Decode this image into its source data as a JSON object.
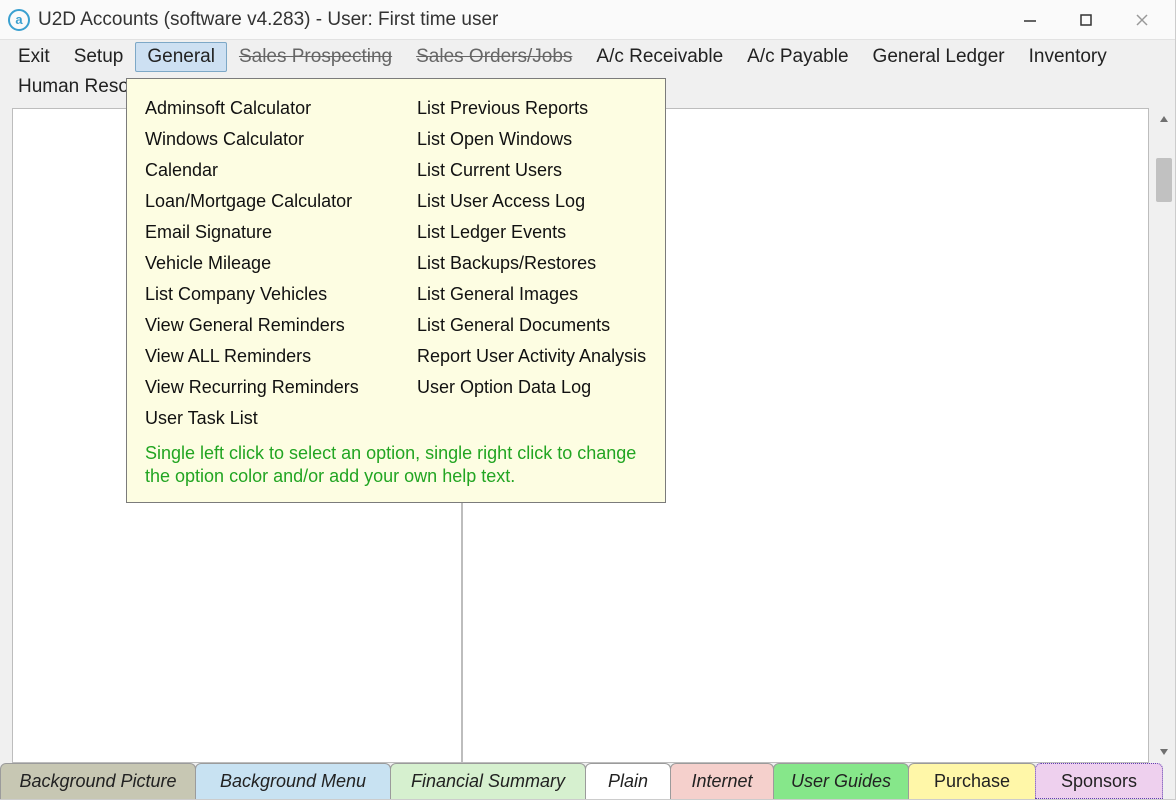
{
  "window": {
    "title": "U2D Accounts (software v4.283) -  User: First time user"
  },
  "menubar": {
    "items": [
      {
        "label": "Exit",
        "state": "normal"
      },
      {
        "label": "Setup",
        "state": "normal"
      },
      {
        "label": "General",
        "state": "selected"
      },
      {
        "label": "Sales Prospecting",
        "state": "struck"
      },
      {
        "label": "Sales Orders/Jobs",
        "state": "struck"
      },
      {
        "label": "A/c Receivable",
        "state": "normal"
      },
      {
        "label": "A/c Payable",
        "state": "normal"
      },
      {
        "label": "General Ledger",
        "state": "normal"
      },
      {
        "label": "Inventory",
        "state": "normal"
      },
      {
        "label": "Human Resources",
        "state": "normal"
      }
    ]
  },
  "dropdown": {
    "col1": [
      "Adminsoft Calculator",
      "Windows Calculator",
      "Calendar",
      "Loan/Mortgage Calculator",
      "Email Signature",
      "Vehicle Mileage",
      "List Company Vehicles",
      "View General Reminders",
      "View ALL Reminders",
      "View Recurring Reminders",
      "User Task List"
    ],
    "col2": [
      "List Previous Reports",
      "List Open Windows",
      "List Current Users",
      "List User Access Log",
      "List Ledger Events",
      "List Backups/Restores",
      "List General Images",
      "List General Documents",
      "Report User Activity Analysis",
      "User Option Data Log"
    ],
    "hint": "Single left click to select an option, single right click to change the option color and/or add your own help text."
  },
  "tabs": {
    "bgpic": "Background Picture",
    "bgmenu": "Background Menu",
    "finsum": "Financial Summary",
    "plain": "Plain",
    "internet": "Internet",
    "ug": "User Guides",
    "purchase": "Purchase",
    "sponsors": "Sponsors"
  }
}
